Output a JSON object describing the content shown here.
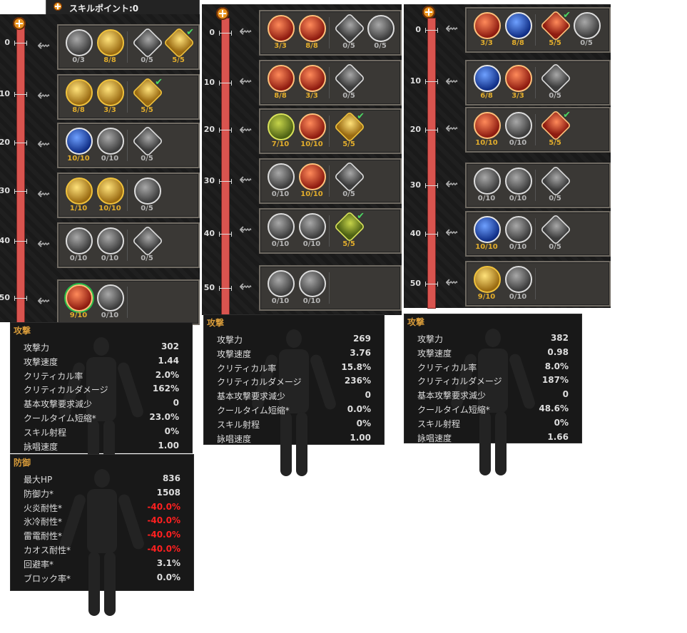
{
  "skill_points_label": "スキルポイント:0",
  "colors": {
    "track": "#d9544f",
    "gold": "#e2ad2c",
    "negative": "#ff2020",
    "header": "#d79b3a"
  },
  "trees": [
    {
      "levels": [
        "0",
        "10",
        "20",
        "30",
        "40",
        "50"
      ],
      "rows": [
        {
          "skills": [
            {
              "icon": "sword-grey-icon",
              "count": "0/3",
              "style": "grey"
            },
            {
              "icon": "helm-gold-icon",
              "count": "8/8",
              "style": "gold"
            },
            {
              "icon": "cracked-shield-icon",
              "count": "0/5",
              "style": "grey",
              "shade": true
            },
            {
              "icon": "fist-gold-icon",
              "count": "5/5",
              "style": "gold",
              "shade": true,
              "check": true
            }
          ]
        },
        {
          "skills": [
            {
              "icon": "shield-gold-icon",
              "count": "8/8",
              "style": "gold"
            },
            {
              "icon": "helm-gold-icon",
              "count": "3/3",
              "style": "gold"
            },
            {
              "icon": "armor-gold-icon",
              "count": "5/5",
              "style": "gold",
              "shade": true,
              "check": true
            }
          ]
        },
        {
          "skills": [
            {
              "icon": "hourglass-blue-icon",
              "count": "10/10",
              "style": "blue"
            },
            {
              "icon": "arrows-grey-icon",
              "count": "0/10",
              "style": "grey"
            },
            {
              "icon": "spade-grey-icon",
              "count": "0/5",
              "style": "grey",
              "shade": true
            }
          ]
        },
        {
          "skills": [
            {
              "icon": "helm-gold-icon",
              "count": "1/10",
              "style": "gold"
            },
            {
              "icon": "helm-gold-icon",
              "count": "10/10",
              "style": "gold"
            },
            {
              "icon": "glove-grey-icon",
              "count": "0/5",
              "style": "grey"
            }
          ]
        },
        {
          "skills": [
            {
              "icon": "mask-grey-icon",
              "count": "0/10",
              "style": "grey"
            },
            {
              "icon": "chest-grey-icon",
              "count": "0/10",
              "style": "grey"
            },
            {
              "icon": "plate-grey-icon",
              "count": "0/5",
              "style": "grey",
              "shade": true
            }
          ]
        },
        {
          "skills": [
            {
              "icon": "rage-red-icon",
              "count": "9/10",
              "style": "red",
              "ring": true
            },
            {
              "icon": "star-grey-icon",
              "count": "0/10",
              "style": "grey"
            }
          ]
        }
      ]
    },
    {
      "levels": [
        "0",
        "10",
        "20",
        "30",
        "40",
        "50"
      ],
      "rows": [
        {
          "skills": [
            {
              "icon": "strike-red-icon",
              "count": "3/3",
              "style": "red"
            },
            {
              "icon": "slash-red-icon",
              "count": "8/8",
              "style": "red"
            },
            {
              "icon": "blade-grey-icon",
              "count": "0/5",
              "style": "grey",
              "shade": true
            },
            {
              "icon": "swords-grey-icon",
              "count": "0/5",
              "style": "grey"
            }
          ]
        },
        {
          "skills": [
            {
              "icon": "target-red-icon",
              "count": "8/8",
              "style": "red"
            },
            {
              "icon": "burst-red-icon",
              "count": "3/3",
              "style": "red"
            },
            {
              "icon": "claws-grey-icon",
              "count": "0/5",
              "style": "grey",
              "shade": true
            }
          ]
        },
        {
          "skills": [
            {
              "icon": "boot-green-icon",
              "count": "7/10",
              "style": "green"
            },
            {
              "icon": "spiral-red-icon",
              "count": "10/10",
              "style": "red"
            },
            {
              "icon": "arrow-up-gold-icon",
              "count": "5/5",
              "style": "gold",
              "shade": true,
              "check": true
            }
          ]
        },
        {
          "skills": [
            {
              "icon": "boot-grey-icon",
              "count": "0/10",
              "style": "grey"
            },
            {
              "icon": "slash-red-icon",
              "count": "10/10",
              "style": "red"
            },
            {
              "icon": "dagger-grey-icon",
              "count": "0/5",
              "style": "grey",
              "shade": true
            }
          ]
        },
        {
          "skills": [
            {
              "icon": "boot-grey-icon",
              "count": "0/10",
              "style": "grey"
            },
            {
              "icon": "mask-grey-icon",
              "count": "0/10",
              "style": "grey"
            },
            {
              "icon": "clover-gold-icon",
              "count": "5/5",
              "style": "green",
              "shade": true,
              "check": true
            }
          ]
        },
        {
          "skills": [
            {
              "icon": "boot-grey-icon",
              "count": "0/10",
              "style": "grey"
            },
            {
              "icon": "hand-grey-icon",
              "count": "0/10",
              "style": "grey"
            }
          ]
        }
      ]
    },
    {
      "levels": [
        "0",
        "10",
        "20",
        "30",
        "40",
        "50"
      ],
      "rows": [
        {
          "skills": [
            {
              "icon": "strike-red-icon",
              "count": "3/3",
              "style": "red"
            },
            {
              "icon": "hourglass-blue-icon",
              "count": "8/8",
              "style": "blue"
            },
            {
              "icon": "gem-red-icon",
              "count": "5/5",
              "style": "red",
              "shade": true,
              "check": true
            },
            {
              "icon": "spear-grey-icon",
              "count": "0/5",
              "style": "grey"
            }
          ]
        },
        {
          "skills": [
            {
              "icon": "eye-blue-icon",
              "count": "6/8",
              "style": "blue"
            },
            {
              "icon": "target-red-icon",
              "count": "3/3",
              "style": "red"
            },
            {
              "icon": "net-grey-icon",
              "count": "0/5",
              "style": "grey",
              "shade": true
            }
          ]
        },
        {
          "skills": [
            {
              "icon": "rune-red-icon",
              "count": "10/10",
              "style": "red"
            },
            {
              "icon": "orb-grey-icon",
              "count": "0/10",
              "style": "grey"
            },
            {
              "icon": "banner-red-icon",
              "count": "5/5",
              "style": "red",
              "shade": true,
              "check": true
            }
          ]
        },
        {
          "skills": [
            {
              "icon": "wind-grey-icon",
              "count": "0/10",
              "style": "grey"
            },
            {
              "icon": "mask-grey-icon",
              "count": "0/10",
              "style": "grey"
            },
            {
              "icon": "sparkle-grey-icon",
              "count": "0/5",
              "style": "grey",
              "shade": true
            }
          ]
        },
        {
          "skills": [
            {
              "icon": "hourglass-blue-icon",
              "count": "10/10",
              "style": "blue"
            },
            {
              "icon": "cut-grey-icon",
              "count": "0/10",
              "style": "grey"
            },
            {
              "icon": "cube-grey-icon",
              "count": "0/5",
              "style": "grey",
              "shade": true
            }
          ]
        },
        {
          "skills": [
            {
              "icon": "helm-gold-icon",
              "count": "9/10",
              "style": "gold"
            },
            {
              "icon": "star-grey-icon",
              "count": "0/10",
              "style": "grey"
            }
          ]
        }
      ]
    }
  ],
  "stat_panels": [
    {
      "title": "攻撃",
      "rows": [
        [
          "攻撃力",
          "302"
        ],
        [
          "攻撃速度",
          "1.44"
        ],
        [
          "クリティカル率",
          "2.0%"
        ],
        [
          "クリティカルダメージ",
          "162%"
        ],
        [
          "基本攻撃要求減少",
          "0"
        ],
        [
          "クールタイム短縮*",
          "23.0%"
        ],
        [
          "スキル射程",
          "0%"
        ],
        [
          "詠唱速度",
          "1.00"
        ]
      ]
    },
    {
      "title": "攻撃",
      "rows": [
        [
          "攻撃力",
          "269"
        ],
        [
          "攻撃速度",
          "3.76"
        ],
        [
          "クリティカル率",
          "15.8%"
        ],
        [
          "クリティカルダメージ",
          "236%"
        ],
        [
          "基本攻撃要求減少",
          "0"
        ],
        [
          "クールタイム短縮*",
          "0.0%"
        ],
        [
          "スキル射程",
          "0%"
        ],
        [
          "詠唱速度",
          "1.00"
        ]
      ]
    },
    {
      "title": "攻撃",
      "rows": [
        [
          "攻撃力",
          "382"
        ],
        [
          "攻撃速度",
          "0.98"
        ],
        [
          "クリティカル率",
          "8.0%"
        ],
        [
          "クリティカルダメージ",
          "187%"
        ],
        [
          "基本攻撃要求減少",
          "0"
        ],
        [
          "クールタイム短縮*",
          "48.6%"
        ],
        [
          "スキル射程",
          "0%"
        ],
        [
          "詠唱速度",
          "1.66"
        ]
      ]
    },
    {
      "title": "防御",
      "rows": [
        [
          "最大HP",
          "836"
        ],
        [
          "防御力*",
          "1508"
        ],
        [
          "火炎耐性*",
          "-40.0%"
        ],
        [
          "氷冷耐性*",
          "-40.0%"
        ],
        [
          "雷電耐性*",
          "-40.0%"
        ],
        [
          "カオス耐性*",
          "-40.0%"
        ],
        [
          "回避率*",
          "3.1%"
        ],
        [
          "ブロック率*",
          "0.0%"
        ]
      ]
    }
  ]
}
